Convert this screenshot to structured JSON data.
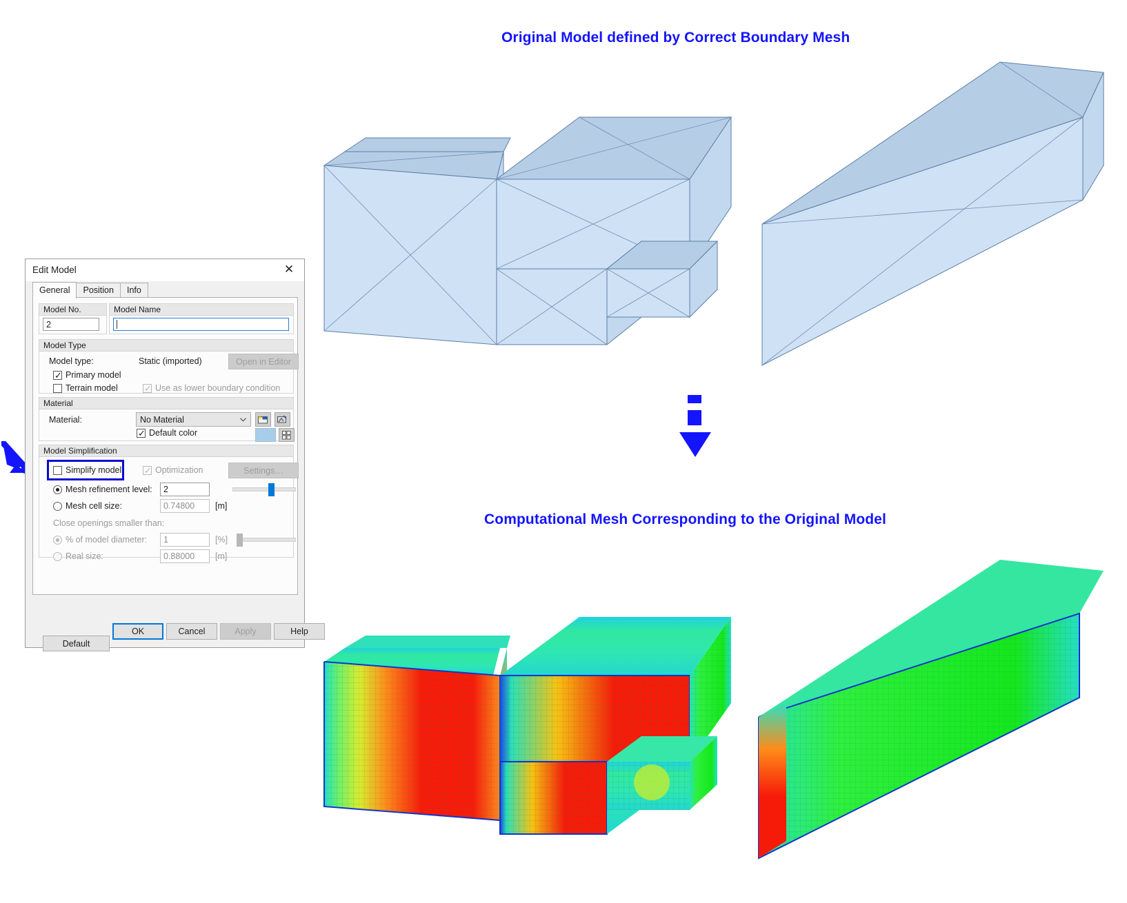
{
  "annotations": {
    "top_title": "Original Model defined by Correct Boundary Mesh",
    "bottom_title": "Computational Mesh Corresponding to the Original Model",
    "accent_color": "#1414ff",
    "arrow_icon": "down-arrow-icon",
    "callout_icon": "callout-arrow-icon"
  },
  "dialog": {
    "title": "Edit Model",
    "close_label": "✕",
    "tabs": [
      {
        "label": "General",
        "active": true
      },
      {
        "label": "Position",
        "active": false
      },
      {
        "label": "Info",
        "active": false
      }
    ],
    "model_no": {
      "group_label": "Model No.",
      "value": "2"
    },
    "model_name": {
      "group_label": "Model Name",
      "value": "",
      "placeholder": ""
    },
    "model_type": {
      "group_label": "Model Type",
      "type_label": "Model type:",
      "type_value": "Static (imported)",
      "open_editor_button": "Open in Editor",
      "primary_model": {
        "label": "Primary model",
        "checked": true,
        "enabled": true
      },
      "terrain_model": {
        "label": "Terrain model",
        "checked": false,
        "enabled": true
      },
      "lower_boundary": {
        "label": "Use as lower boundary condition",
        "checked": true,
        "enabled": false
      }
    },
    "material": {
      "group_label": "Material",
      "label": "Material:",
      "selected": "No Material",
      "new_material_icon": "new-material-icon",
      "edit_material_icon": "edit-material-icon",
      "default_color": {
        "label": "Default color",
        "checked": true
      },
      "color_value": "#a8cdea",
      "color_picker_icon": "color-grid-icon"
    },
    "simplification": {
      "group_label": "Model Simplification",
      "simplify_model": {
        "label": "Simplify model",
        "checked": false,
        "highlighted": true
      },
      "optimization": {
        "label": "Optimization",
        "checked": true,
        "enabled": false
      },
      "settings_button": {
        "label": "Settings…",
        "enabled": false
      },
      "mesh_refinement": {
        "label": "Mesh refinement level:",
        "selected": true,
        "value": "2",
        "slider_percent": 62
      },
      "mesh_cell_size": {
        "label": "Mesh cell size:",
        "selected": false,
        "value": "0.74800",
        "unit": "[m]"
      },
      "close_openings_label": "Close openings smaller than:",
      "percent_of_diameter": {
        "label": "% of model diameter:",
        "selected": true,
        "enabled": false,
        "value": "1",
        "unit": "[%]",
        "slider_percent": 4
      },
      "real_size": {
        "label": "Real size:",
        "selected": false,
        "enabled": false,
        "value": "0.88000",
        "unit": "[m]"
      }
    },
    "default_button": "Default",
    "footer_buttons": [
      {
        "label": "OK",
        "default": true,
        "enabled": true
      },
      {
        "label": "Cancel",
        "default": false,
        "enabled": true
      },
      {
        "label": "Apply",
        "default": false,
        "enabled": false
      },
      {
        "label": "Help",
        "default": false,
        "enabled": true
      }
    ]
  }
}
